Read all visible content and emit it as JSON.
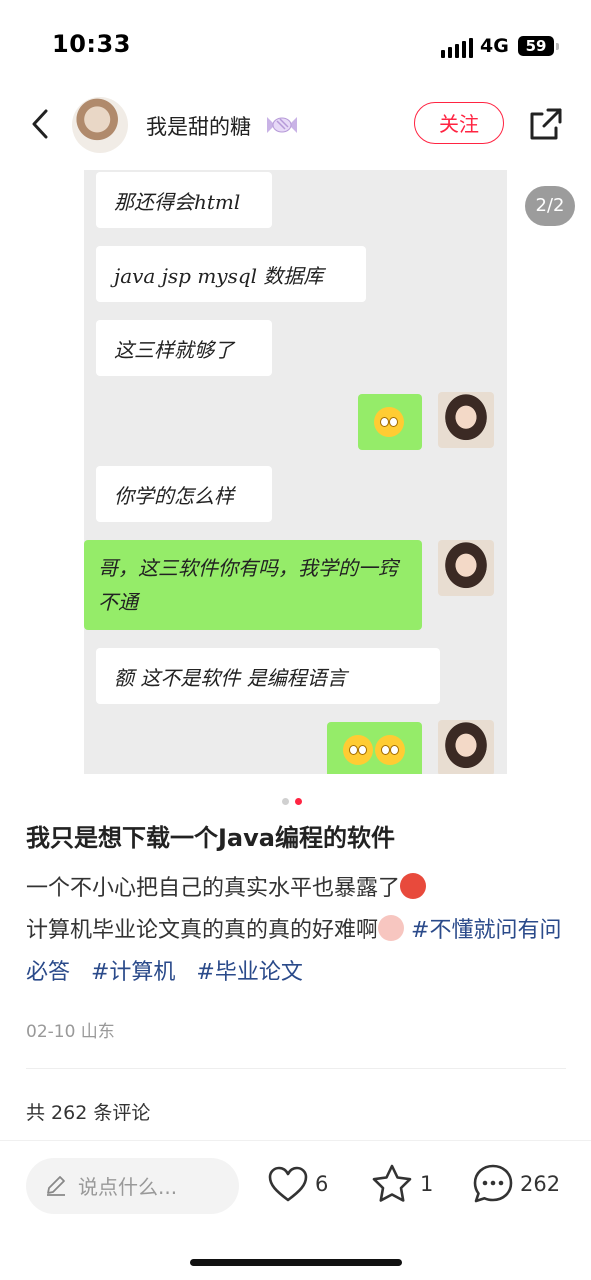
{
  "status_bar": {
    "time": "10:33",
    "network": "4G",
    "battery": "59"
  },
  "header": {
    "username": "我是甜的糖",
    "follow_label": "关注"
  },
  "gallery": {
    "counter": "2/2",
    "page_count": 2,
    "current_page": 2
  },
  "chat": [
    {
      "side": "left",
      "text": "那还得会html"
    },
    {
      "side": "left",
      "text": "java jsp  mysql 数据库"
    },
    {
      "side": "left",
      "text": "这三样就够了"
    },
    {
      "side": "right",
      "text": "",
      "emoji": "surprised-face"
    },
    {
      "side": "left",
      "text": "你学的怎么样"
    },
    {
      "side": "right",
      "text": "哥，这三软件你有吗，我学的一窍不通"
    },
    {
      "side": "left",
      "text": "额  这不是软件  是编程语言"
    },
    {
      "side": "right",
      "text": "",
      "emoji": "flushed-face-x2"
    }
  ],
  "post": {
    "title": "我只是想下载一个Java编程的软件",
    "line1": "一个不小心把自己的真实水平也暴露了",
    "line2": "计算机毕业论文真的真的真的好难啊",
    "tags": [
      "#不懂就问有问必答",
      "#计算机",
      "#毕业论文"
    ],
    "meta": "02-10 山东"
  },
  "comments": {
    "total_label": "共 262 条评论"
  },
  "bottom_bar": {
    "input_placeholder": "说点什么...",
    "likes": "6",
    "collects": "1",
    "comments": "262"
  },
  "colors": {
    "accent": "#ff2442",
    "tag": "#2a4a8a",
    "wechat_green": "#95ec69"
  }
}
